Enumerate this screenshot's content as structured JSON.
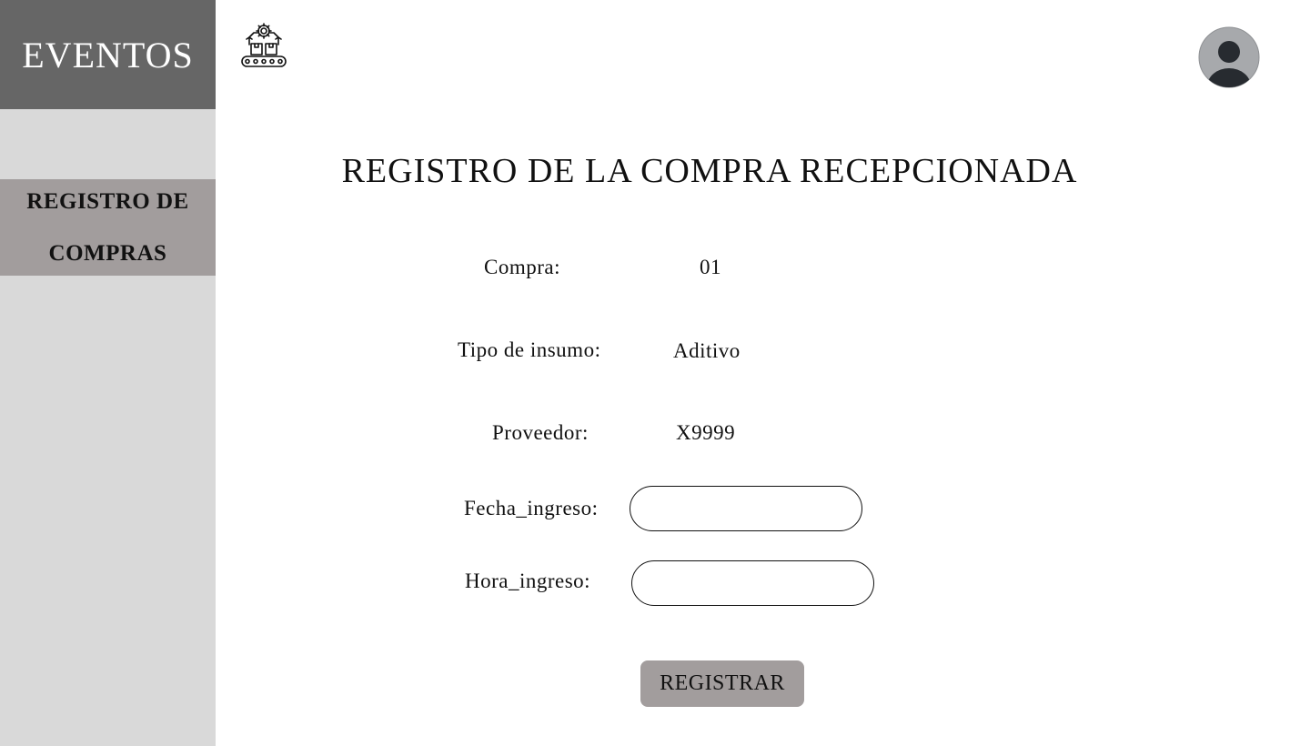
{
  "sidebar": {
    "brand": "EVENTOS",
    "items": [
      {
        "label": "REGISTRO DE COMPRAS",
        "active": true
      }
    ],
    "colors": {
      "brand_bg": "#666666",
      "sidebar_bg": "#d9d9d9",
      "active_item_bg": "#a29d9d"
    }
  },
  "header": {
    "app_icon": "conveyor-belt-factory-icon",
    "user_icon": "user-avatar-icon"
  },
  "main": {
    "title": "REGISTRO DE LA COMPRA RECEPCIONADA",
    "fields": {
      "compra": {
        "label": "Compra:",
        "value": "01"
      },
      "tipo_insumo": {
        "label": "Tipo de insumo:",
        "value": "Aditivo"
      },
      "proveedor": {
        "label": "Proveedor:",
        "value": "X9999"
      },
      "fecha_ingreso": {
        "label": "Fecha_ingreso:",
        "value": "",
        "placeholder": ""
      },
      "hora_ingreso": {
        "label": "Hora_ingreso:",
        "value": "",
        "placeholder": ""
      }
    },
    "submit_label": "REGISTRAR",
    "colors": {
      "button_bg": "#a29d9d"
    }
  }
}
